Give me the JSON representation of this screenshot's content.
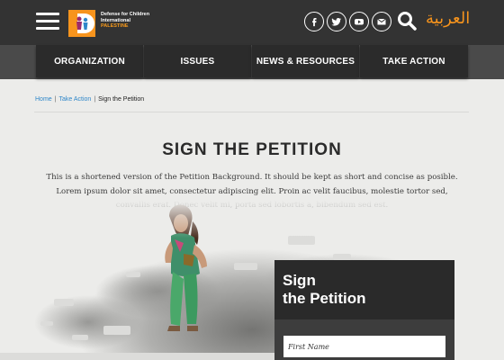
{
  "header": {
    "logo_text_line1": "Defense for Children",
    "logo_text_line2": "International",
    "logo_text_line3": "PALESTINE",
    "social_icons": [
      "facebook-icon",
      "twitter-icon",
      "youtube-icon",
      "email-icon"
    ],
    "language_link": "العربية"
  },
  "nav": {
    "items": [
      {
        "label": "ORGANIZATION"
      },
      {
        "label": "ISSUES"
      },
      {
        "label": "NEWS & RESOURCES"
      },
      {
        "label": "TAKE ACTION"
      }
    ]
  },
  "breadcrumb": {
    "home": "Home",
    "separator": "|",
    "parent": "Take Action",
    "current": "Sign the Petition"
  },
  "page": {
    "title": "SIGN THE PETITION",
    "intro": "This is a shortened version of the Petition Background.  It should be kept as short and concise as posible. Lorem ipsum dolor sit amet, consectetur adipiscing elit. Proin ac velit faucibus, molestie tortor sed, convallis erat. Donec velit mi, porta sed lobortis a, bibendum sed est."
  },
  "petition": {
    "title_line1": "Sign",
    "title_line2": "the Petition",
    "first_name_placeholder": "First Name"
  },
  "colors": {
    "accent": "#f7941d",
    "link": "#2f87c9",
    "header_bg": "#333333",
    "nav_bg": "#2b2b2b"
  }
}
